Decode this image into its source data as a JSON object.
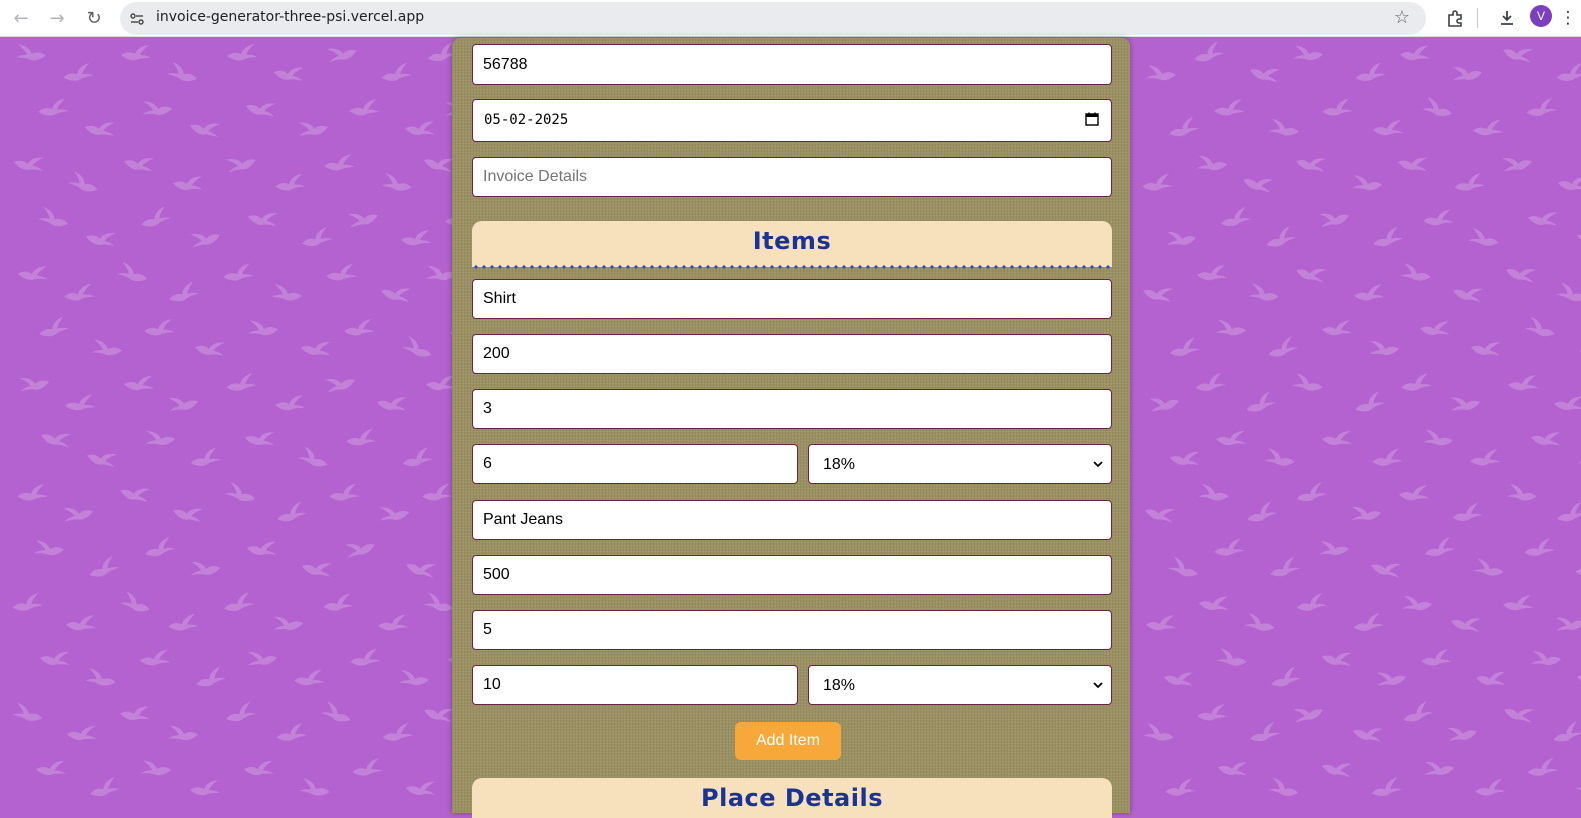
{
  "browser": {
    "url": "invoice-generator-three-psi.vercel.app",
    "avatar_letter": "V"
  },
  "colors": {
    "background": "#b462cf",
    "panel": "#9b9163",
    "section_header": "#f7e0bc",
    "section_title": "#1a3493",
    "field_border": "#6b2448",
    "add_button": "#f6a83a"
  },
  "invoice": {
    "number_value": "56788",
    "date_value": "05-02-2025",
    "details_placeholder": "Invoice Details"
  },
  "items_section": {
    "title": "Items",
    "items": [
      {
        "name": "Shirt",
        "price": "200",
        "quantity": "3",
        "discount": "6",
        "tax": "18%"
      },
      {
        "name": "Pant Jeans",
        "price": "500",
        "quantity": "5",
        "discount": "10",
        "tax": "18%"
      }
    ],
    "add_button_label": "Add Item"
  },
  "place_section": {
    "title": "Place Details"
  }
}
